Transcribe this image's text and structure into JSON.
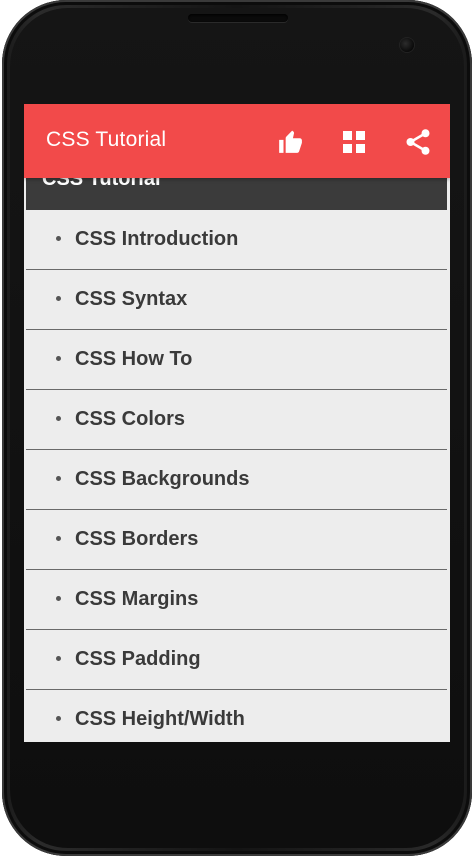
{
  "app_bar": {
    "title": "CSS Tutorial",
    "background_color": "#f24a4a",
    "actions": [
      {
        "name": "like",
        "icon": "thumbs-up-icon"
      },
      {
        "name": "grid",
        "icon": "grid-icon"
      },
      {
        "name": "share",
        "icon": "share-icon"
      }
    ]
  },
  "section": {
    "header": "CSS Tutorial",
    "items": [
      {
        "label": "CSS Introduction"
      },
      {
        "label": "CSS Syntax"
      },
      {
        "label": "CSS How To"
      },
      {
        "label": "CSS Colors"
      },
      {
        "label": "CSS Backgrounds"
      },
      {
        "label": "CSS Borders"
      },
      {
        "label": "CSS Margins"
      },
      {
        "label": "CSS Padding"
      },
      {
        "label": "CSS Height/Width"
      }
    ]
  }
}
